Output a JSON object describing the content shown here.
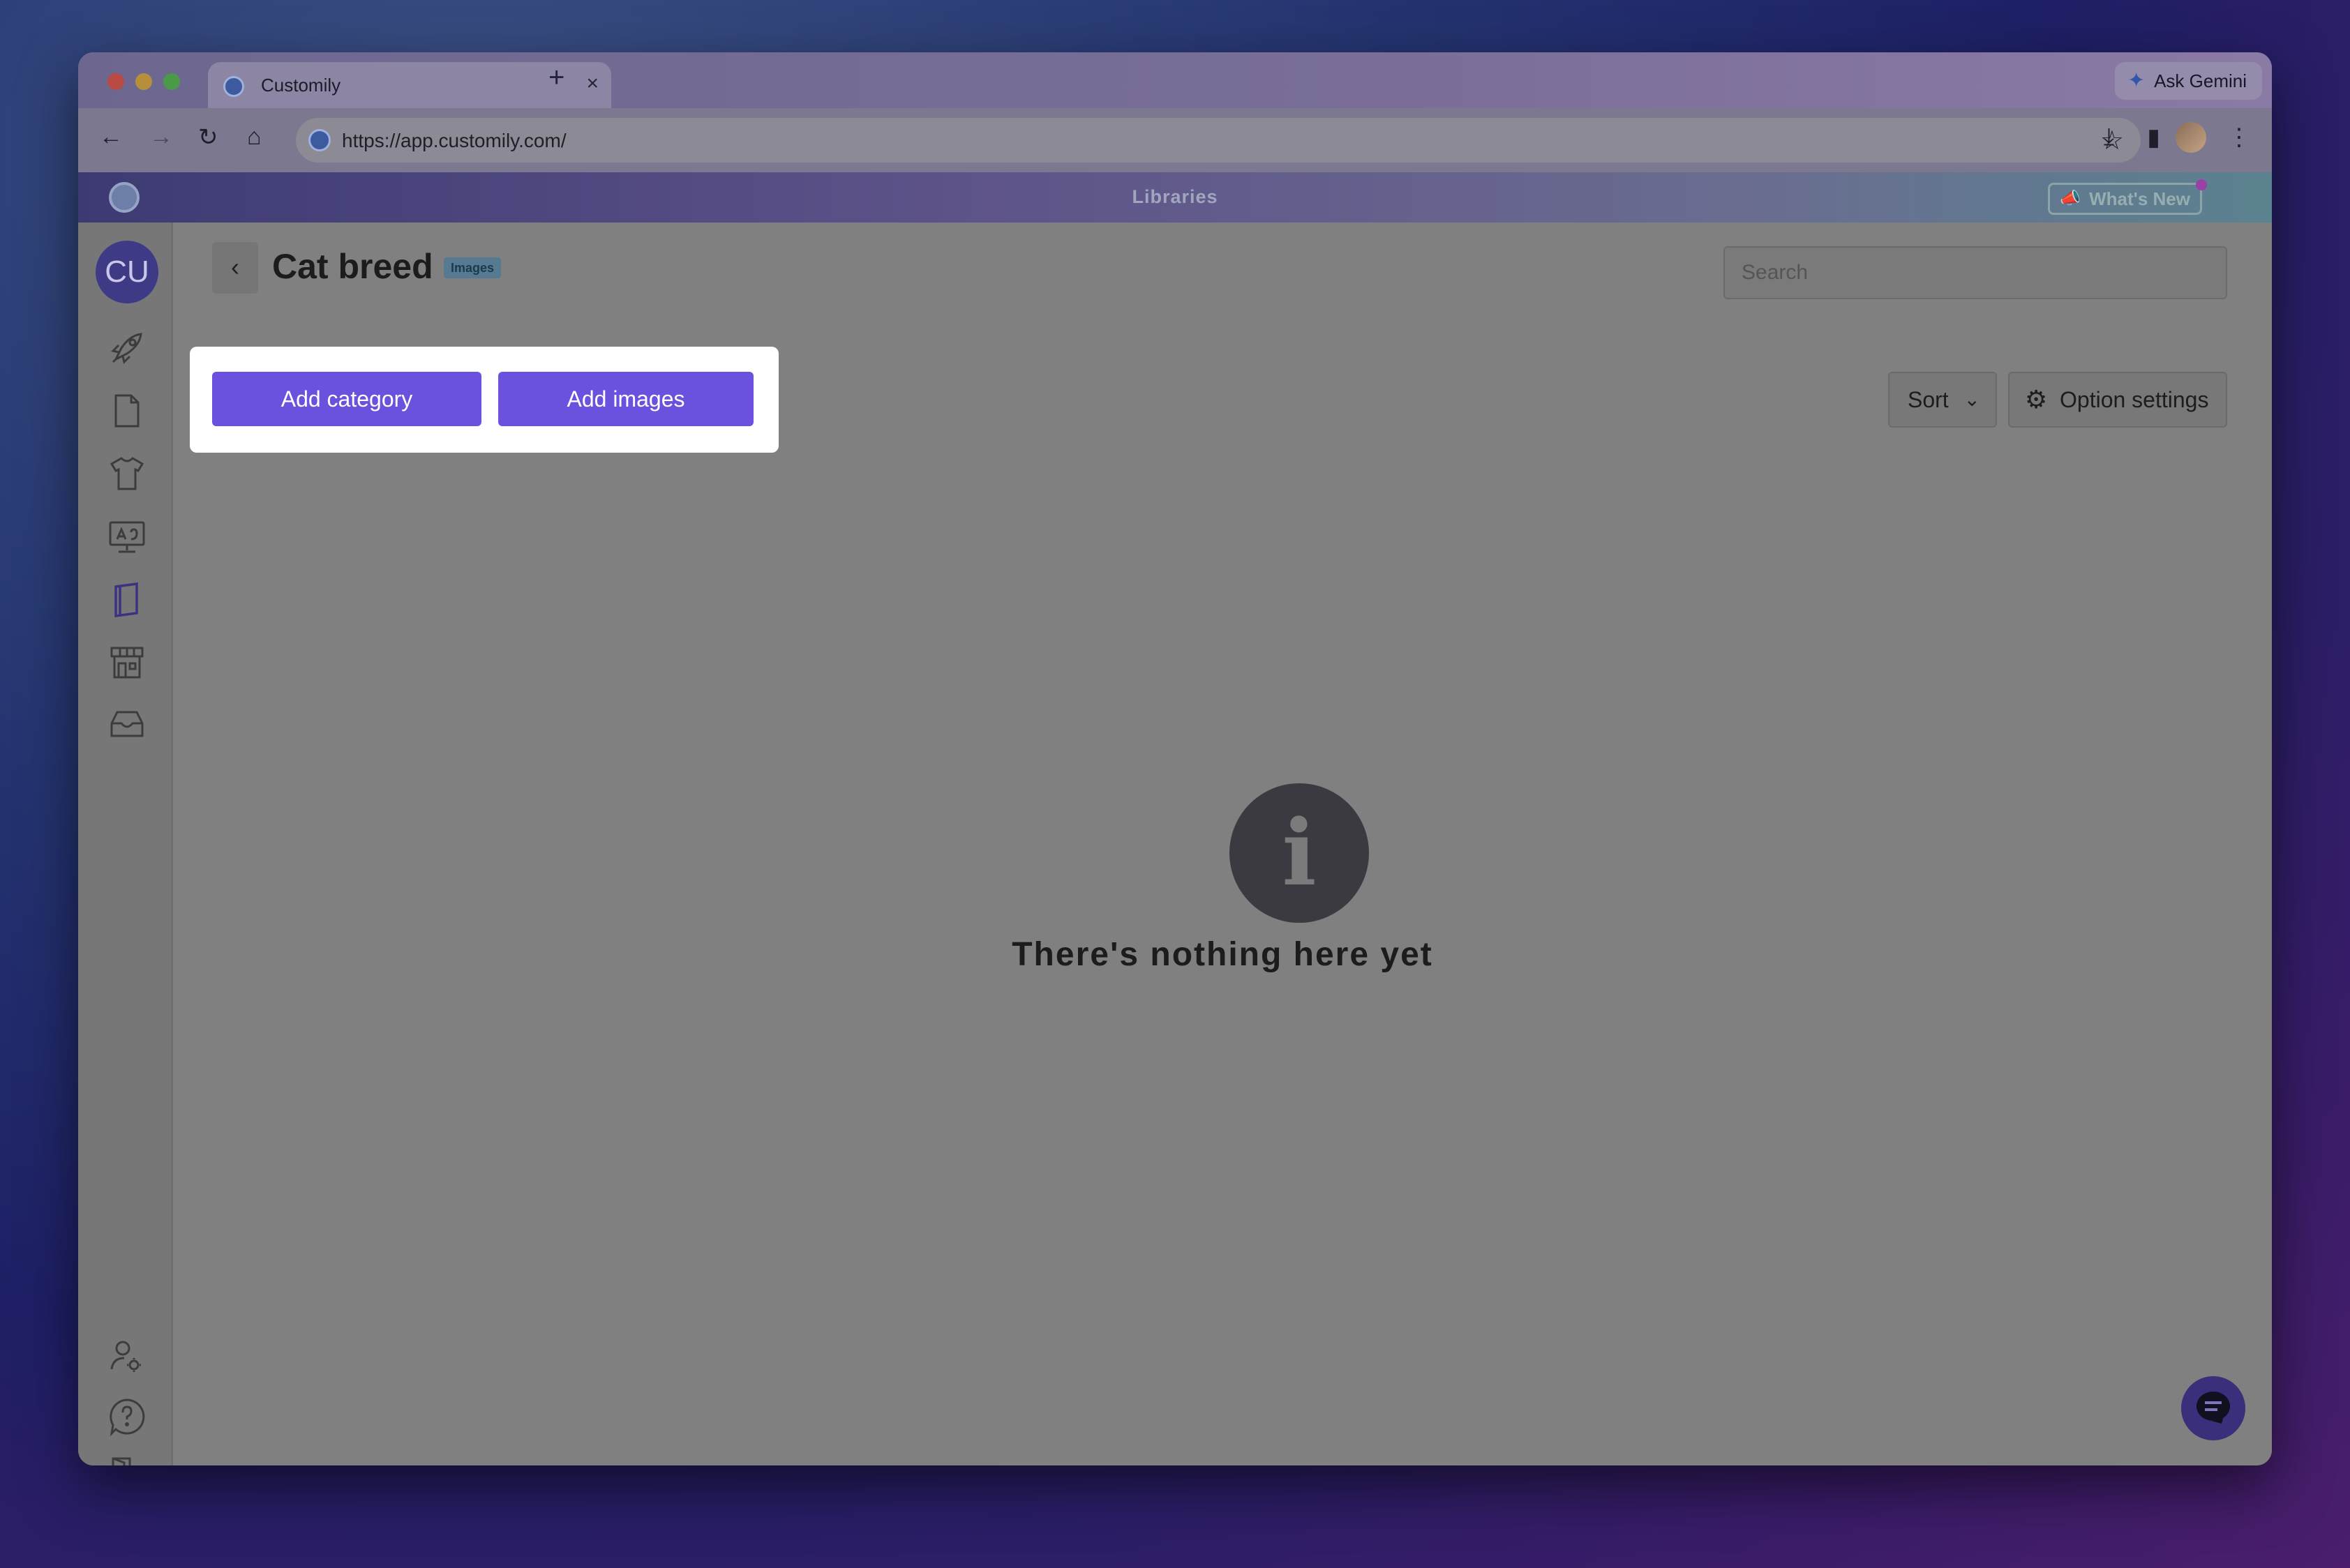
{
  "browser": {
    "tab_title": "Customily",
    "tab_close": "×",
    "new_tab": "+",
    "ask_gemini": "Ask Gemini",
    "url": "https://app.customily.com/"
  },
  "app_header": {
    "title": "Libraries",
    "whats_new": "What's New"
  },
  "sidebar": {
    "avatar_initials": "CU",
    "items": [
      "rocket-icon",
      "document-icon",
      "tshirt-icon",
      "monitor-icon",
      "book-icon",
      "store-icon",
      "inbox-icon"
    ],
    "bottom_items": [
      "user-settings-icon",
      "help-icon",
      "logout-icon"
    ]
  },
  "main": {
    "back": "‹",
    "title": "Cat breed",
    "badge": "Images",
    "search_placeholder": "Search",
    "add_category": "Add category",
    "add_images": "Add images",
    "sort_label": "Sort",
    "option_settings": "Option settings",
    "empty_icon": "i",
    "empty_message": "There's nothing here yet"
  },
  "colors": {
    "primary": "#6b51de",
    "avatar_bg": "#3f3a86"
  }
}
